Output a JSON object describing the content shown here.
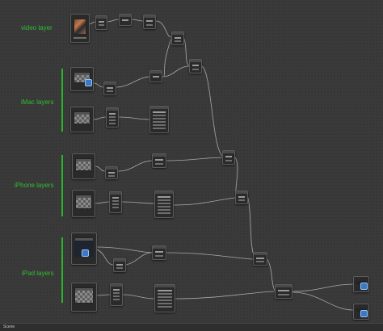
{
  "groups": {
    "video": "video  layer",
    "imac": "iMac layers",
    "iphone": "iPhone layers",
    "ipad": "iPad layers"
  },
  "status_bar": {
    "scene_label": "Scene"
  },
  "colors": {
    "background": "#3a3a3a",
    "node_body": "#2a2a2a",
    "group_label": "#2fbf2f",
    "wire": "#bdbdbd"
  },
  "node_editor": {
    "node_kinds": [
      "image-reader",
      "transform",
      "merge",
      "shuffle",
      "viewer"
    ]
  }
}
